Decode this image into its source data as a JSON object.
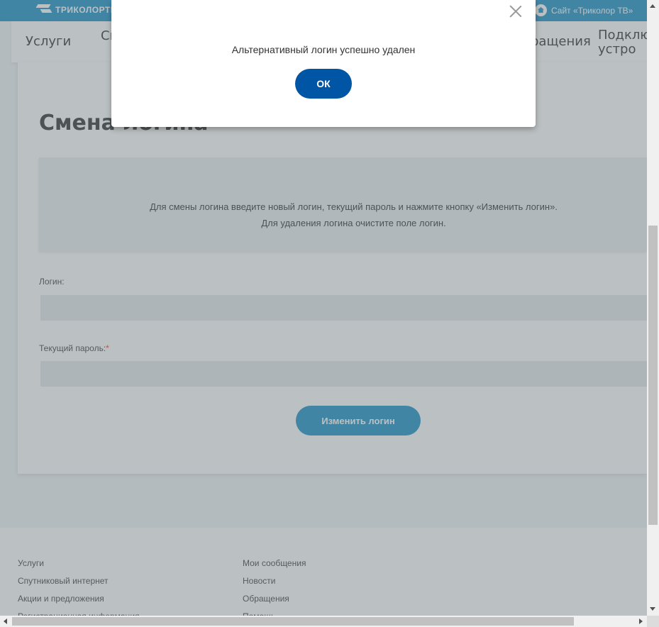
{
  "header": {
    "logo_text": "ТРИКОЛОРТВ",
    "site_link": "Сайт «Триколор ТВ»"
  },
  "nav": {
    "items": [
      "Услуги",
      "Сп",
      "ращения",
      "Подклю",
      "устро"
    ]
  },
  "page": {
    "title": "Смена логина",
    "info_line1": "Для смены логина введите новый логин, текущий пароль и нажмите кнопку «Изменить логин».",
    "info_line2": "Для удаления логина очистите поле логин.",
    "login_label": "Логин:",
    "login_value": "",
    "password_label": "Текущий пароль:",
    "password_required": "*",
    "password_value": "",
    "submit_label": "Изменить логин"
  },
  "footer": {
    "col1": [
      "Услуги",
      "Спутниковый интернет",
      "Акции и предложения",
      "Регистрационная информация"
    ],
    "col2": [
      "Мои сообщения",
      "Новости",
      "Обращения",
      "Помощь"
    ]
  },
  "modal": {
    "message": "Альтернативный логин успешно удален",
    "ok_label": "ОК"
  },
  "colors": {
    "brand": "#0b88c4",
    "modal_button": "#0055a5"
  }
}
